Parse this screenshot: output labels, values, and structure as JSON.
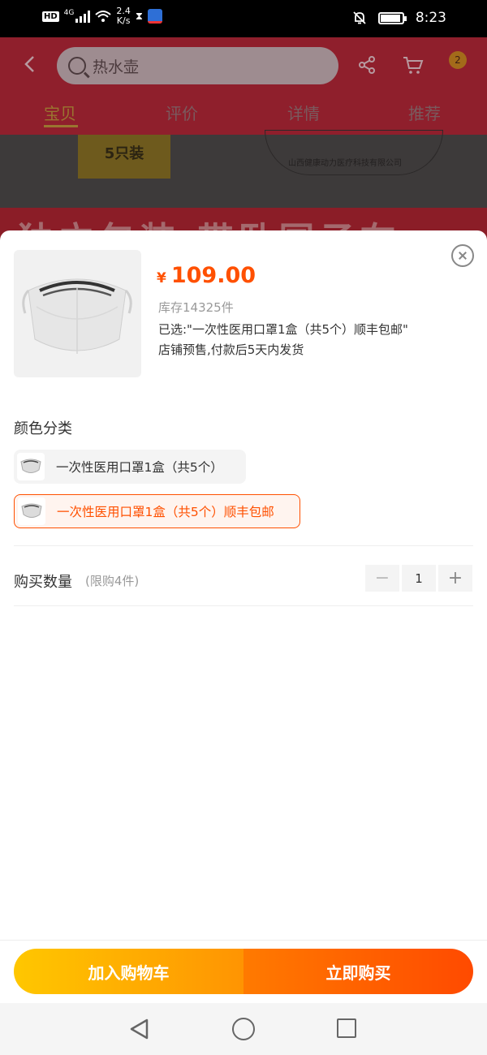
{
  "status_bar": {
    "network": "4G",
    "hd": "HD",
    "speed": "2.4\nK/s",
    "speed_value": "2.4",
    "speed_unit": "K/s",
    "time": "8:23"
  },
  "background_page": {
    "search_placeholder": "热水壶",
    "cart_badge": "2",
    "tabs": [
      "宝贝",
      "评价",
      "详情",
      "推荐"
    ],
    "active_tab": "宝贝",
    "banner_box_text": "5只装",
    "banner_company": "山西健康动力医疗科技有限公司",
    "banner_big_text": "独立包装 带卧国子在"
  },
  "sku_sheet": {
    "currency": "¥",
    "price": "109.00",
    "stock": "库存14325件",
    "selected": "已选:\"一次性医用口罩1盒（共5个）顺丰包邮\"",
    "shipping": "店铺预售,付款后5天内发货",
    "color_section_title": "颜色分类",
    "options": [
      {
        "label": "一次性医用口罩1盒（共5个）",
        "selected": false
      },
      {
        "label": "一次性医用口罩1盒（共5个）顺丰包邮",
        "selected": true
      }
    ],
    "quantity_label": "购买数量",
    "quantity_limit": "(限购4件)",
    "quantity_value": "1",
    "add_to_cart": "加入购物车",
    "buy_now": "立即购买"
  },
  "colors": {
    "accent": "#ff5000",
    "cart_gradient_start": "#ffc700",
    "buy_gradient_end": "#ff4a00"
  }
}
